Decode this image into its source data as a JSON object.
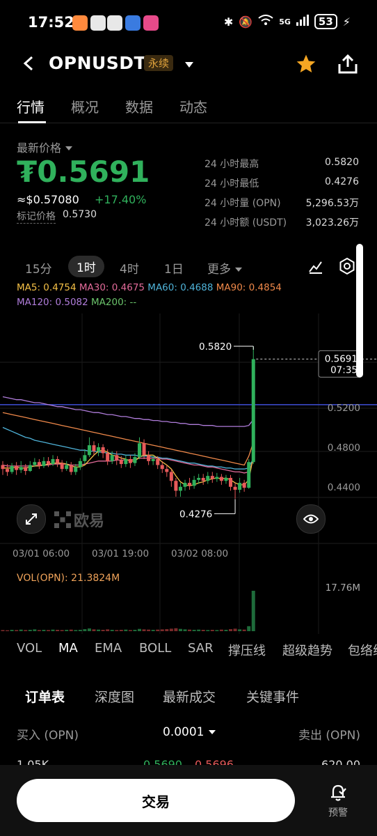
{
  "status_bar": {
    "time": "17:52",
    "network": "5G",
    "battery": "53"
  },
  "header": {
    "symbol": "OPNUSDT",
    "contract_badge": "永续"
  },
  "tabs": [
    {
      "label": "行情",
      "active": true
    },
    {
      "label": "概况",
      "active": false
    },
    {
      "label": "数据",
      "active": false
    },
    {
      "label": "动态",
      "active": false
    }
  ],
  "ticker": {
    "latest_price_label": "最新价格",
    "price": "₮0.5691",
    "usd_price": "≈$0.57080",
    "change_pct": "+17.40%",
    "mark_label": "标记价格",
    "mark_price": "0.5730",
    "stats": [
      {
        "label": "24 小时最高",
        "value": "0.5820"
      },
      {
        "label": "24 小时最低",
        "value": "0.4276"
      },
      {
        "label": "24 小时量 (OPN)",
        "value": "5,296.53万"
      },
      {
        "label": "24 小时额 (USDT)",
        "value": "3,023.26万"
      }
    ]
  },
  "intervals": [
    {
      "label": "15分",
      "active": false
    },
    {
      "label": "1时",
      "active": true
    },
    {
      "label": "4时",
      "active": false
    },
    {
      "label": "1日",
      "active": false
    },
    {
      "label": "更多",
      "active": false
    }
  ],
  "ma": {
    "ma5": "MA5: 0.4754",
    "ma30": "MA30: 0.4675",
    "ma60": "MA60: 0.4688",
    "ma90": "MA90: 0.4854",
    "ma120": "MA120: 0.5082",
    "ma200": "MA200: --"
  },
  "colors": {
    "up": "#30b15c",
    "down": "#e85a5a",
    "ma5": "#f5c046",
    "ma30": "#e36b9a",
    "ma60": "#4fb3d9",
    "ma90": "#f0894a",
    "ma120": "#b07ddb",
    "ma200": "#6bc46b",
    "accent_star": "#f5a623",
    "blue_line": "#3f4fd8"
  },
  "chart_data": {
    "type": "candlestick",
    "interval": "1h",
    "y_ticks": [
      0.44,
      0.48,
      0.52
    ],
    "y_tick_labels": [
      "0.4400",
      "0.4800",
      "0.5200"
    ],
    "x_tick_labels": [
      "03/01 06:00",
      "03/01 19:00",
      "03/02 08:00"
    ],
    "high_label": "0.5820",
    "low_label": "0.4276",
    "last_price_tag": "0.5691",
    "countdown": "07:35",
    "candles": [
      [
        0.462,
        0.458,
        0.466,
        0.452
      ],
      [
        0.458,
        0.455,
        0.463,
        0.451
      ],
      [
        0.455,
        0.461,
        0.464,
        0.453
      ],
      [
        0.461,
        0.457,
        0.465,
        0.452
      ],
      [
        0.457,
        0.46,
        0.466,
        0.454
      ],
      [
        0.46,
        0.456,
        0.463,
        0.452
      ],
      [
        0.456,
        0.462,
        0.466,
        0.455
      ],
      [
        0.462,
        0.465,
        0.469,
        0.46
      ],
      [
        0.465,
        0.461,
        0.468,
        0.458
      ],
      [
        0.461,
        0.466,
        0.47,
        0.459
      ],
      [
        0.466,
        0.463,
        0.47,
        0.46
      ],
      [
        0.463,
        0.468,
        0.472,
        0.461
      ],
      [
        0.468,
        0.464,
        0.471,
        0.46
      ],
      [
        0.464,
        0.458,
        0.467,
        0.455
      ],
      [
        0.458,
        0.462,
        0.466,
        0.456
      ],
      [
        0.462,
        0.455,
        0.465,
        0.452
      ],
      [
        0.455,
        0.46,
        0.463,
        0.452
      ],
      [
        0.46,
        0.466,
        0.469,
        0.457
      ],
      [
        0.466,
        0.472,
        0.478,
        0.463
      ],
      [
        0.472,
        0.482,
        0.49,
        0.47
      ],
      [
        0.482,
        0.476,
        0.486,
        0.472
      ],
      [
        0.476,
        0.48,
        0.484,
        0.471
      ],
      [
        0.48,
        0.474,
        0.483,
        0.469
      ],
      [
        0.474,
        0.466,
        0.478,
        0.462
      ],
      [
        0.466,
        0.472,
        0.476,
        0.463
      ],
      [
        0.472,
        0.467,
        0.476,
        0.462
      ],
      [
        0.467,
        0.463,
        0.471,
        0.459
      ],
      [
        0.463,
        0.468,
        0.472,
        0.46
      ],
      [
        0.468,
        0.464,
        0.472,
        0.459
      ],
      [
        0.464,
        0.47,
        0.474,
        0.461
      ],
      [
        0.47,
        0.484,
        0.49,
        0.468
      ],
      [
        0.484,
        0.472,
        0.488,
        0.468
      ],
      [
        0.472,
        0.466,
        0.476,
        0.462
      ],
      [
        0.466,
        0.468,
        0.472,
        0.462
      ],
      [
        0.468,
        0.462,
        0.471,
        0.458
      ],
      [
        0.462,
        0.458,
        0.466,
        0.454
      ],
      [
        0.458,
        0.455,
        0.462,
        0.45
      ],
      [
        0.455,
        0.446,
        0.458,
        0.44
      ],
      [
        0.446,
        0.436,
        0.449,
        0.43
      ],
      [
        0.436,
        0.44,
        0.444,
        0.43
      ],
      [
        0.44,
        0.444,
        0.447,
        0.436
      ],
      [
        0.444,
        0.441,
        0.449,
        0.437
      ],
      [
        0.441,
        0.447,
        0.451,
        0.438
      ],
      [
        0.447,
        0.449,
        0.453,
        0.443
      ],
      [
        0.449,
        0.446,
        0.453,
        0.442
      ],
      [
        0.446,
        0.451,
        0.455,
        0.443
      ],
      [
        0.451,
        0.448,
        0.455,
        0.444
      ],
      [
        0.448,
        0.45,
        0.454,
        0.445
      ],
      [
        0.45,
        0.446,
        0.453,
        0.442
      ],
      [
        0.446,
        0.449,
        0.452,
        0.443
      ],
      [
        0.449,
        0.44,
        0.452,
        0.436
      ],
      [
        0.44,
        0.437,
        0.444,
        0.428
      ],
      [
        0.437,
        0.444,
        0.449,
        0.434
      ],
      [
        0.444,
        0.439,
        0.447,
        0.435
      ],
      [
        0.439,
        0.465,
        0.468,
        0.438
      ],
      [
        0.465,
        0.569,
        0.582,
        0.463
      ]
    ],
    "ma5": [
      0.459,
      0.459,
      0.459,
      0.46,
      0.459,
      0.459,
      0.46,
      0.461,
      0.461,
      0.462,
      0.463,
      0.464,
      0.464,
      0.464,
      0.463,
      0.461,
      0.46,
      0.46,
      0.462,
      0.467,
      0.472,
      0.476,
      0.477,
      0.475,
      0.472,
      0.471,
      0.469,
      0.468,
      0.466,
      0.466,
      0.47,
      0.472,
      0.472,
      0.472,
      0.469,
      0.465,
      0.462,
      0.458,
      0.451,
      0.445,
      0.442,
      0.441,
      0.442,
      0.444,
      0.445,
      0.447,
      0.448,
      0.449,
      0.448,
      0.449,
      0.447,
      0.444,
      0.442,
      0.442,
      0.447,
      0.471
    ],
    "ma30": [
      0.462,
      0.461,
      0.461,
      0.461,
      0.461,
      0.461,
      0.461,
      0.461,
      0.462,
      0.462,
      0.462,
      0.463,
      0.463,
      0.463,
      0.463,
      0.462,
      0.462,
      0.462,
      0.463,
      0.464,
      0.465,
      0.466,
      0.466,
      0.466,
      0.466,
      0.467,
      0.467,
      0.467,
      0.467,
      0.468,
      0.469,
      0.469,
      0.469,
      0.469,
      0.469,
      0.468,
      0.468,
      0.467,
      0.466,
      0.465,
      0.464,
      0.463,
      0.462,
      0.462,
      0.461,
      0.46,
      0.46,
      0.459,
      0.458,
      0.457,
      0.456,
      0.455,
      0.455,
      0.454,
      0.455,
      0.467
    ],
    "ma60": [
      0.5,
      0.498,
      0.496,
      0.494,
      0.492,
      0.49,
      0.489,
      0.487,
      0.486,
      0.485,
      0.484,
      0.483,
      0.482,
      0.481,
      0.48,
      0.479,
      0.478,
      0.477,
      0.477,
      0.476,
      0.476,
      0.475,
      0.475,
      0.474,
      0.474,
      0.473,
      0.473,
      0.472,
      0.472,
      0.472,
      0.471,
      0.471,
      0.471,
      0.47,
      0.47,
      0.469,
      0.469,
      0.468,
      0.467,
      0.466,
      0.465,
      0.464,
      0.464,
      0.463,
      0.462,
      0.461,
      0.461,
      0.46,
      0.46,
      0.459,
      0.459,
      0.458,
      0.458,
      0.458,
      0.459,
      0.469
    ],
    "ma90": [
      0.515,
      0.514,
      0.513,
      0.512,
      0.511,
      0.51,
      0.509,
      0.508,
      0.507,
      0.506,
      0.505,
      0.504,
      0.503,
      0.502,
      0.501,
      0.5,
      0.499,
      0.498,
      0.497,
      0.496,
      0.495,
      0.494,
      0.493,
      0.492,
      0.491,
      0.49,
      0.489,
      0.488,
      0.487,
      0.486,
      0.485,
      0.484,
      0.483,
      0.482,
      0.481,
      0.48,
      0.479,
      0.478,
      0.477,
      0.476,
      0.475,
      0.474,
      0.473,
      0.472,
      0.471,
      0.47,
      0.469,
      0.468,
      0.467,
      0.466,
      0.465,
      0.464,
      0.463,
      0.462,
      0.471,
      0.485
    ],
    "ma120": [
      0.531,
      0.53,
      0.529,
      0.528,
      0.528,
      0.527,
      0.526,
      0.525,
      0.525,
      0.524,
      0.523,
      0.522,
      0.521,
      0.521,
      0.52,
      0.519,
      0.518,
      0.518,
      0.517,
      0.516,
      0.515,
      0.515,
      0.514,
      0.513,
      0.513,
      0.512,
      0.511,
      0.511,
      0.51,
      0.509,
      0.509,
      0.508,
      0.508,
      0.507,
      0.507,
      0.506,
      0.506,
      0.505,
      0.505,
      0.504,
      0.504,
      0.503,
      0.503,
      0.503,
      0.502,
      0.502,
      0.502,
      0.501,
      0.501,
      0.501,
      0.501,
      0.501,
      0.501,
      0.501,
      0.502,
      0.508
    ],
    "horizontal_line": 0.523
  },
  "volume": {
    "label": "VOL(OPN): 21.3824M",
    "max_label": "17.76M",
    "values": [
      0.5,
      0.4,
      0.6,
      0.5,
      0.7,
      0.5,
      0.6,
      0.8,
      0.5,
      0.6,
      0.5,
      0.7,
      0.6,
      0.5,
      0.6,
      0.7,
      0.5,
      0.6,
      0.9,
      1.2,
      0.8,
      0.7,
      0.6,
      0.8,
      0.6,
      0.5,
      0.6,
      0.7,
      0.5,
      0.6,
      1.0,
      0.8,
      0.7,
      0.6,
      0.7,
      0.8,
      0.9,
      1.1,
      1.3,
      1.0,
      0.8,
      0.7,
      0.6,
      0.7,
      0.6,
      0.5,
      0.6,
      0.5,
      0.7,
      0.6,
      0.9,
      1.1,
      0.8,
      0.7,
      2.2,
      17.76
    ]
  },
  "chart_controls": {
    "logo": "欧易"
  },
  "indicators": [
    {
      "label": "VOL",
      "active": false
    },
    {
      "label": "MA",
      "active": true
    },
    {
      "label": "EMA",
      "active": false
    },
    {
      "label": "BOLL",
      "active": false
    },
    {
      "label": "SAR",
      "active": false
    },
    {
      "label": "撑压线",
      "active": false
    },
    {
      "label": "超级趋势",
      "active": false
    },
    {
      "label": "包络线",
      "active": false
    }
  ],
  "book_tabs": [
    {
      "label": "订单表",
      "active": true
    },
    {
      "label": "深度图",
      "active": false
    },
    {
      "label": "最新成交",
      "active": false
    },
    {
      "label": "关键事件",
      "active": false
    }
  ],
  "order_book": {
    "buy_label": "买入 (OPN)",
    "precision": "0.0001",
    "sell_label": "卖出 (OPN)",
    "row": {
      "bid_qty": "1.05K",
      "bid_price": "0.5690",
      "ask_price": "0.5696",
      "ask_qty": "620.00"
    }
  },
  "bottom": {
    "trade_button": "交易",
    "alert_label": "预警"
  }
}
